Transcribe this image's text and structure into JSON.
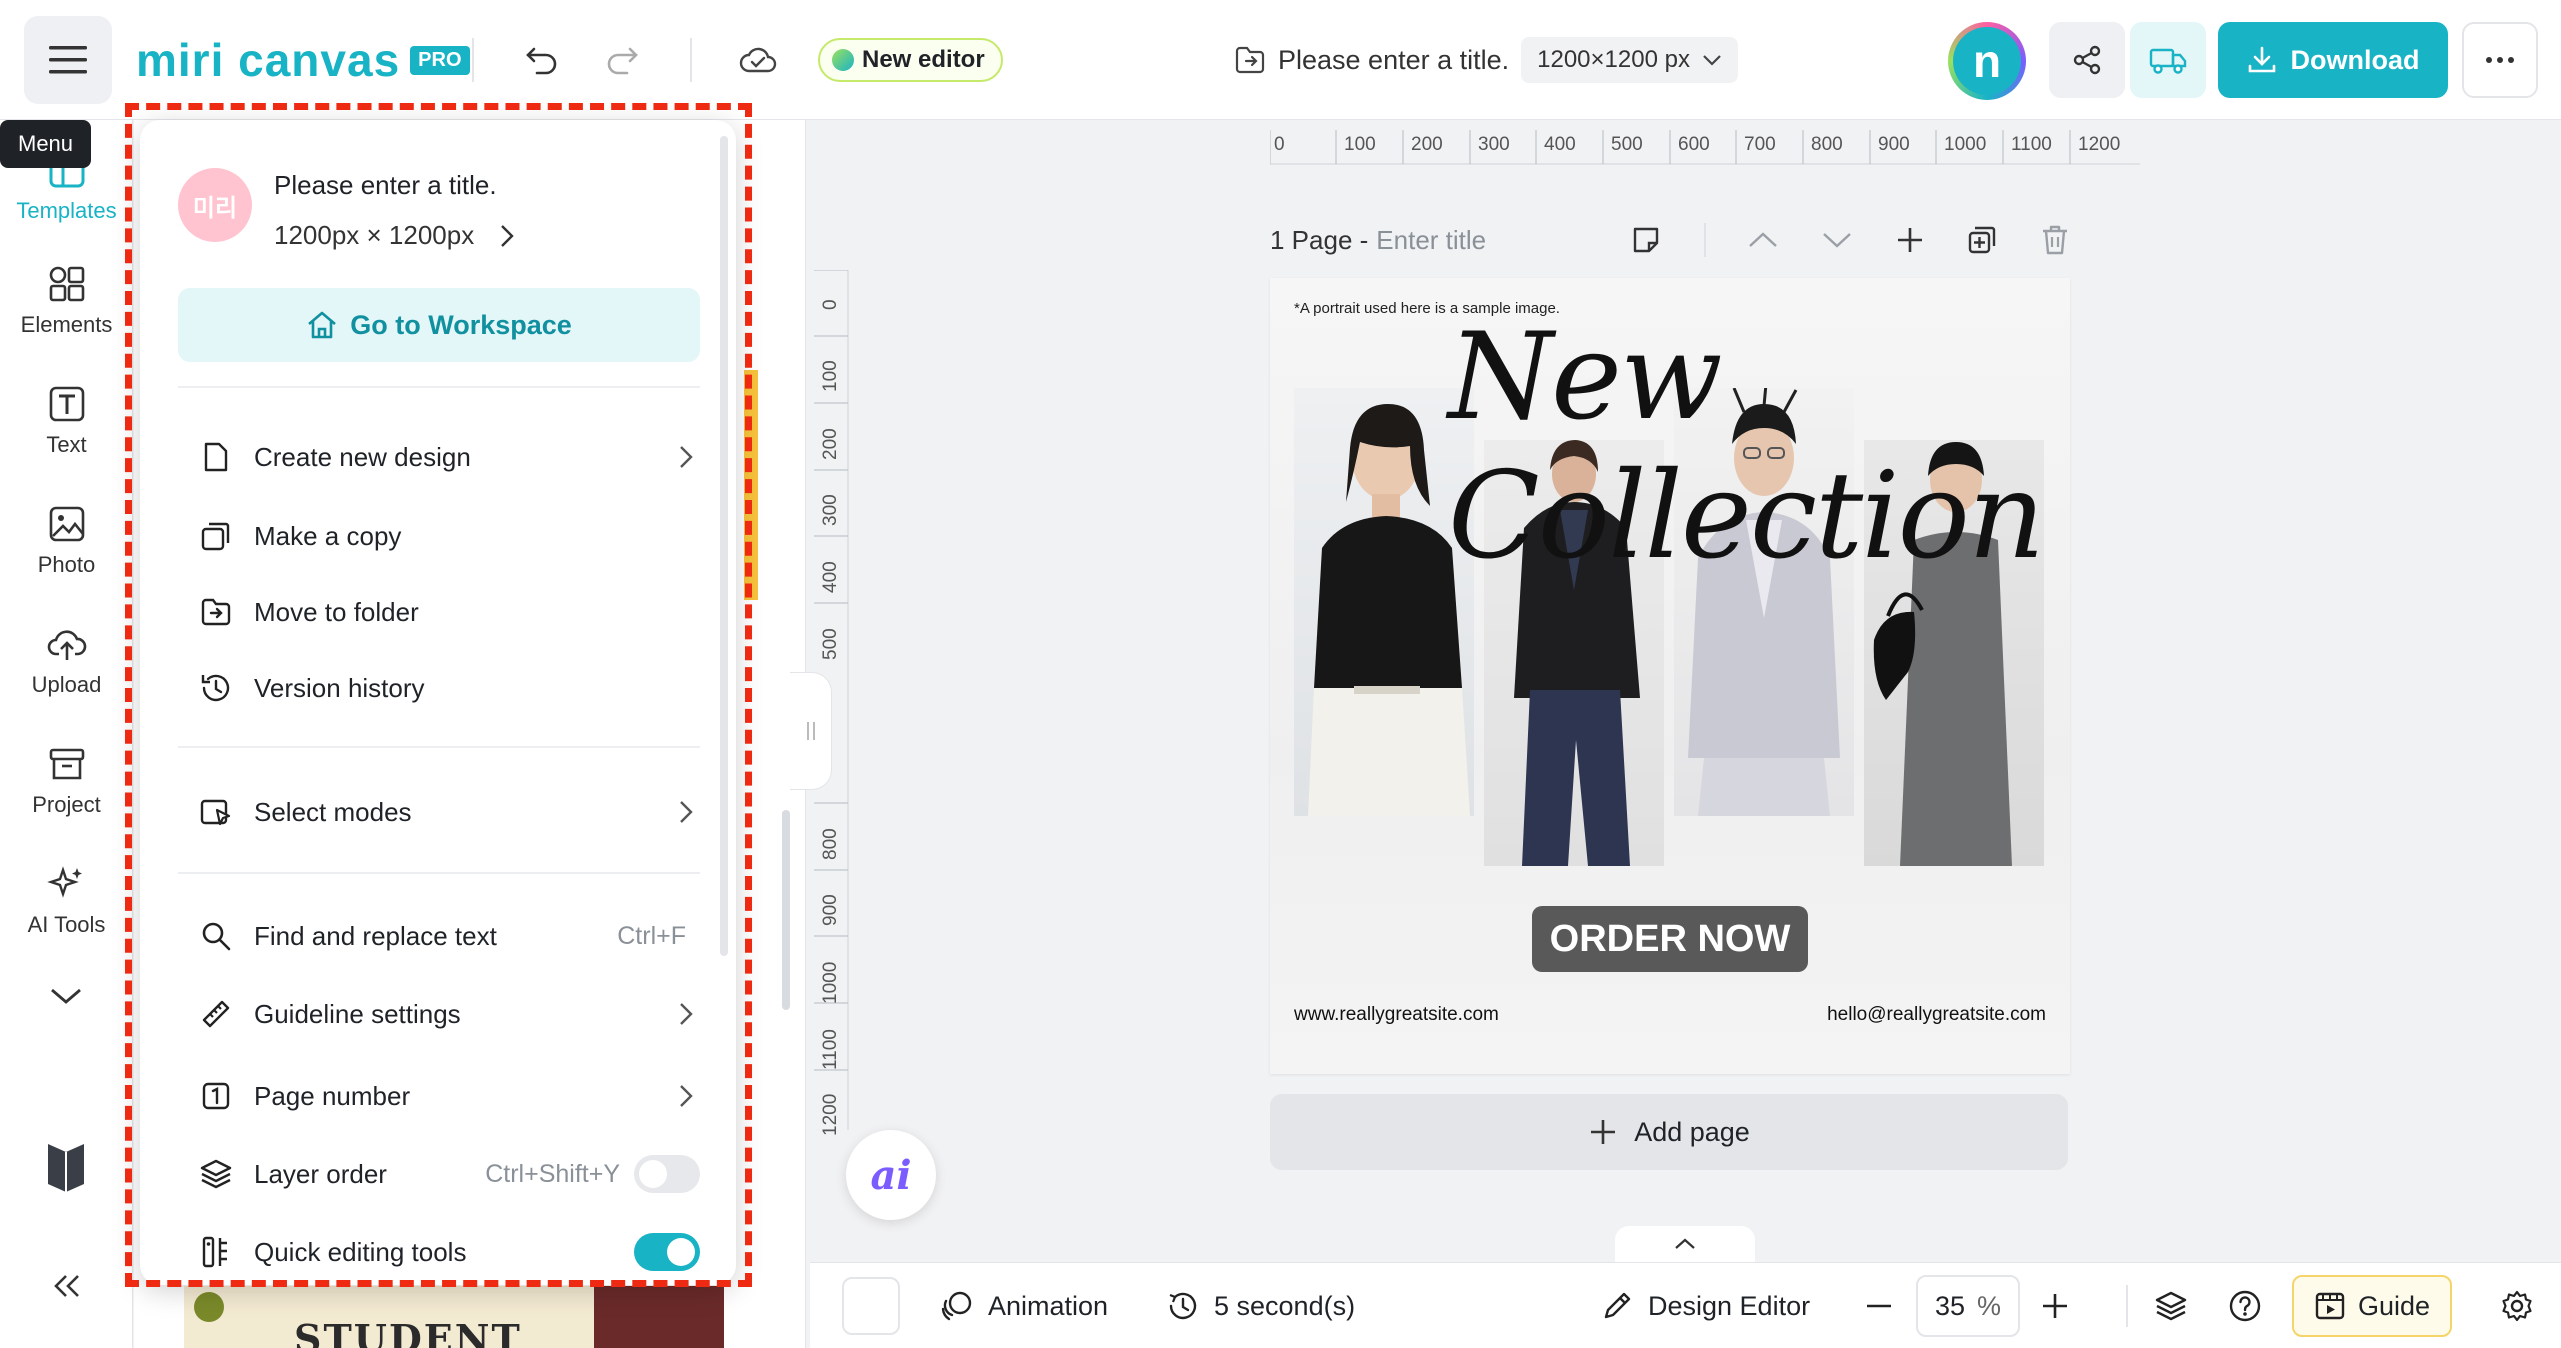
{
  "header": {
    "logo_text": "miri canvas",
    "logo_badge": "PRO",
    "new_editor_label": "New editor",
    "doc_title": "Please enter a title.",
    "doc_size": "1200×1200 px",
    "download_label": "Download"
  },
  "tooltip": {
    "menu": "Menu"
  },
  "sidebar": {
    "items": [
      {
        "label": "Templates",
        "icon": "templates-icon",
        "active": true
      },
      {
        "label": "Elements",
        "icon": "elements-icon"
      },
      {
        "label": "Text",
        "icon": "text-icon"
      },
      {
        "label": "Photo",
        "icon": "photo-icon"
      },
      {
        "label": "Upload",
        "icon": "upload-icon"
      },
      {
        "label": "Project",
        "icon": "project-icon"
      },
      {
        "label": "AI Tools",
        "icon": "ai-tools-icon"
      }
    ]
  },
  "menu": {
    "avatar_text": "미리",
    "title": "Please enter a title.",
    "size": "1200px × 1200px",
    "workspace_label": "Go to Workspace",
    "items": [
      {
        "label": "Create new design",
        "shortcut": "",
        "chevron": true
      },
      {
        "label": "Make a copy",
        "shortcut": "",
        "chevron": false
      },
      {
        "label": "Move to folder",
        "shortcut": "",
        "chevron": false
      },
      {
        "label": "Version history",
        "shortcut": "",
        "chevron": false
      },
      {
        "label": "Select modes",
        "shortcut": "",
        "chevron": true
      },
      {
        "label": "Find and replace text",
        "shortcut": "Ctrl+F",
        "chevron": false
      },
      {
        "label": "Guideline settings",
        "shortcut": "",
        "chevron": true
      },
      {
        "label": "Page number",
        "shortcut": "",
        "chevron": true
      },
      {
        "label": "Layer order",
        "shortcut": "Ctrl+Shift+Y",
        "toggle": false
      },
      {
        "label": "Quick editing tools",
        "shortcut": "",
        "toggle": true
      }
    ]
  },
  "template_panel": {
    "peek_text": "STUDENT"
  },
  "rulers": {
    "top": [
      "0",
      "100",
      "200",
      "300",
      "400",
      "500",
      "600",
      "700",
      "800",
      "900",
      "1000",
      "1100",
      "1200"
    ],
    "left": [
      "0",
      "100",
      "200",
      "300",
      "400",
      "500",
      "800",
      "900",
      "1000",
      "1100",
      "1200"
    ]
  },
  "page": {
    "label": "1 Page -",
    "title_placeholder": "Enter title"
  },
  "design": {
    "note": "*A portrait used here is a sample image.",
    "script_title": "New Collection",
    "cta": "ORDER NOW",
    "website": "www.reallygreatsite.com",
    "email": "hello@reallygreatsite.com"
  },
  "add_page_label": "Add page",
  "ai_label": "ai",
  "bottom": {
    "animation_label": "Animation",
    "duration_label": "5 second(s)",
    "design_editor_label": "Design Editor",
    "zoom_value": "35",
    "zoom_unit": "%",
    "guide_label": "Guide"
  },
  "colors": {
    "brand": "#19b3c6",
    "highlight_dash": "#ef2a12"
  }
}
